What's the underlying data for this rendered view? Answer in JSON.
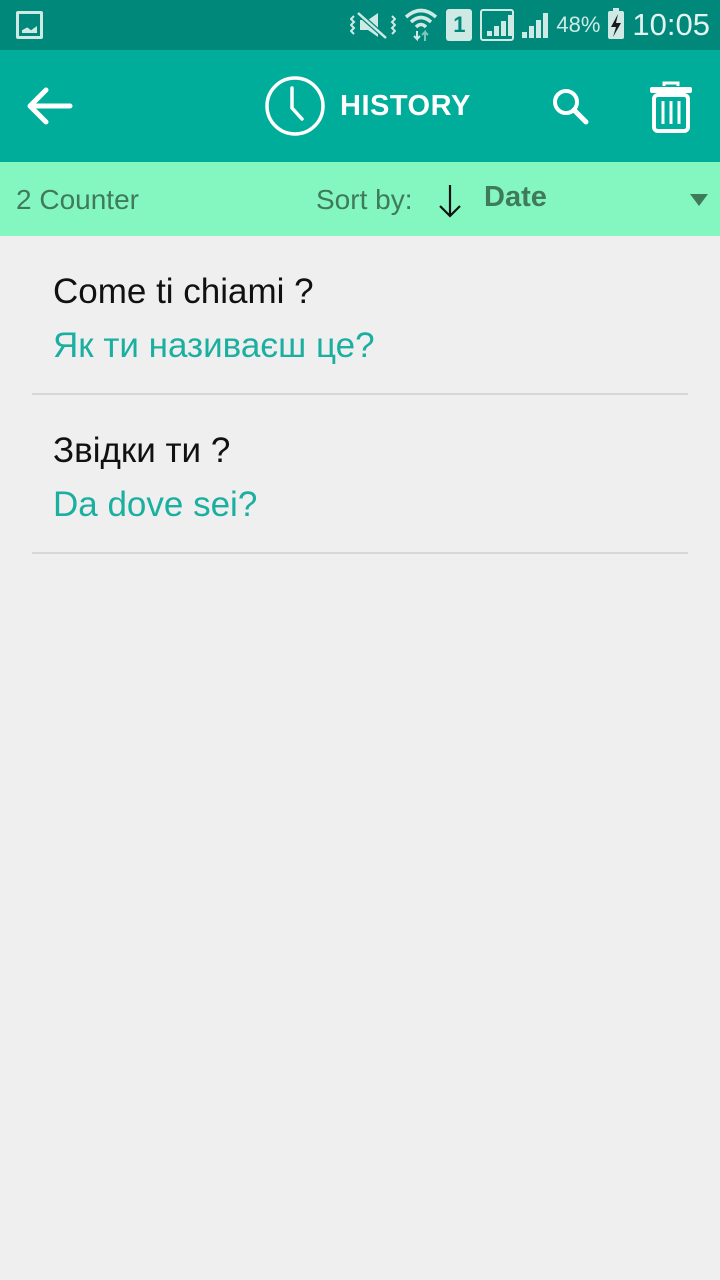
{
  "status_bar": {
    "left_icon": "gallery-notification-icon",
    "icons": [
      "vibrate-mute-icon",
      "wifi-icon",
      "sim-1-icon",
      "signal-sim1-icon",
      "signal-sim2-icon"
    ],
    "sim_label": "1",
    "battery_percent": "48%",
    "battery_icon": "battery-charging-icon",
    "time": "10:05"
  },
  "app_bar": {
    "back_icon": "arrow-left-icon",
    "title_icon": "clock-icon",
    "title": "HISTORY",
    "search_icon": "search-icon",
    "delete_icon": "trash-icon"
  },
  "sort_bar": {
    "counter": "2 Counter",
    "sort_label": "Sort by:",
    "sort_direction_icon": "arrow-down-icon",
    "sort_value": "Date",
    "dropdown_icon": "caret-down-icon"
  },
  "history": [
    {
      "source": "Come ti chiami ?",
      "translation": "Як ти називаєш це?"
    },
    {
      "source": "Звідки ти ?",
      "translation": "Da dove sei?"
    }
  ],
  "colors": {
    "status_bar": "#00897b",
    "app_bar": "#00ad9a",
    "sort_bar": "#84f7c0",
    "translation_text": "#1aafa0",
    "background": "#efefef"
  }
}
